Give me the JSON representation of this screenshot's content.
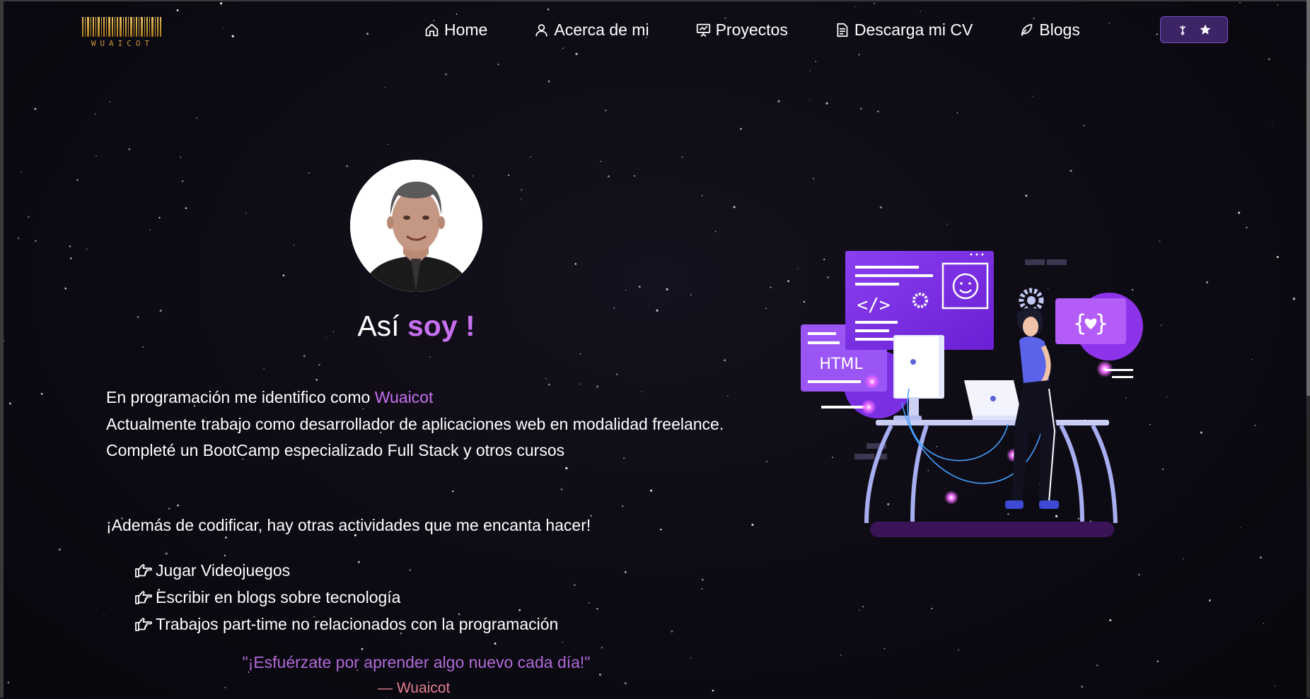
{
  "brand": {
    "logo_text": "WUAICOT",
    "logo_alt": "wuaicot-barcode-logo"
  },
  "nav": {
    "items": [
      {
        "label": "Home",
        "icon": "home-icon"
      },
      {
        "label": "Acerca de mi",
        "icon": "user-icon"
      },
      {
        "label": "Proyectos",
        "icon": "presentation-icon"
      },
      {
        "label": "Descarga mi CV",
        "icon": "document-icon"
      },
      {
        "label": "Blogs",
        "icon": "feather-icon"
      }
    ],
    "actions": {
      "fork_icon": "git-fork-icon",
      "star_icon": "star-icon"
    }
  },
  "hero": {
    "title_prefix": "Así",
    "title_accent": "soy !",
    "intro": {
      "line1_prefix": "En programación me identifico como",
      "line1_name": "Wuaicot",
      "line2": "Actualmente trabajo como desarrollador de aplicaciones web en modalidad freelance.",
      "line3": "Completé un BootCamp especializado Full Stack y otros cursos"
    },
    "hobbies_intro": "¡Además de codificar, hay otras actividades que me encanta hacer!",
    "hobbies": [
      "Jugar Videojuegos",
      "Escribir en blogs sobre tecnología",
      "Trabajos part-time no relacionados con la programación"
    ],
    "quote": "\"¡Esfuérzate por aprender algo nuevo cada día!\"",
    "quote_author": "— Wuaicot"
  },
  "illustration": {
    "html_label": "HTML"
  },
  "colors": {
    "background": "#0d0b13",
    "accent": "#c770f0",
    "quote": "#b06ad8",
    "author": "#e17f93",
    "button_bg": "#3c2467"
  }
}
